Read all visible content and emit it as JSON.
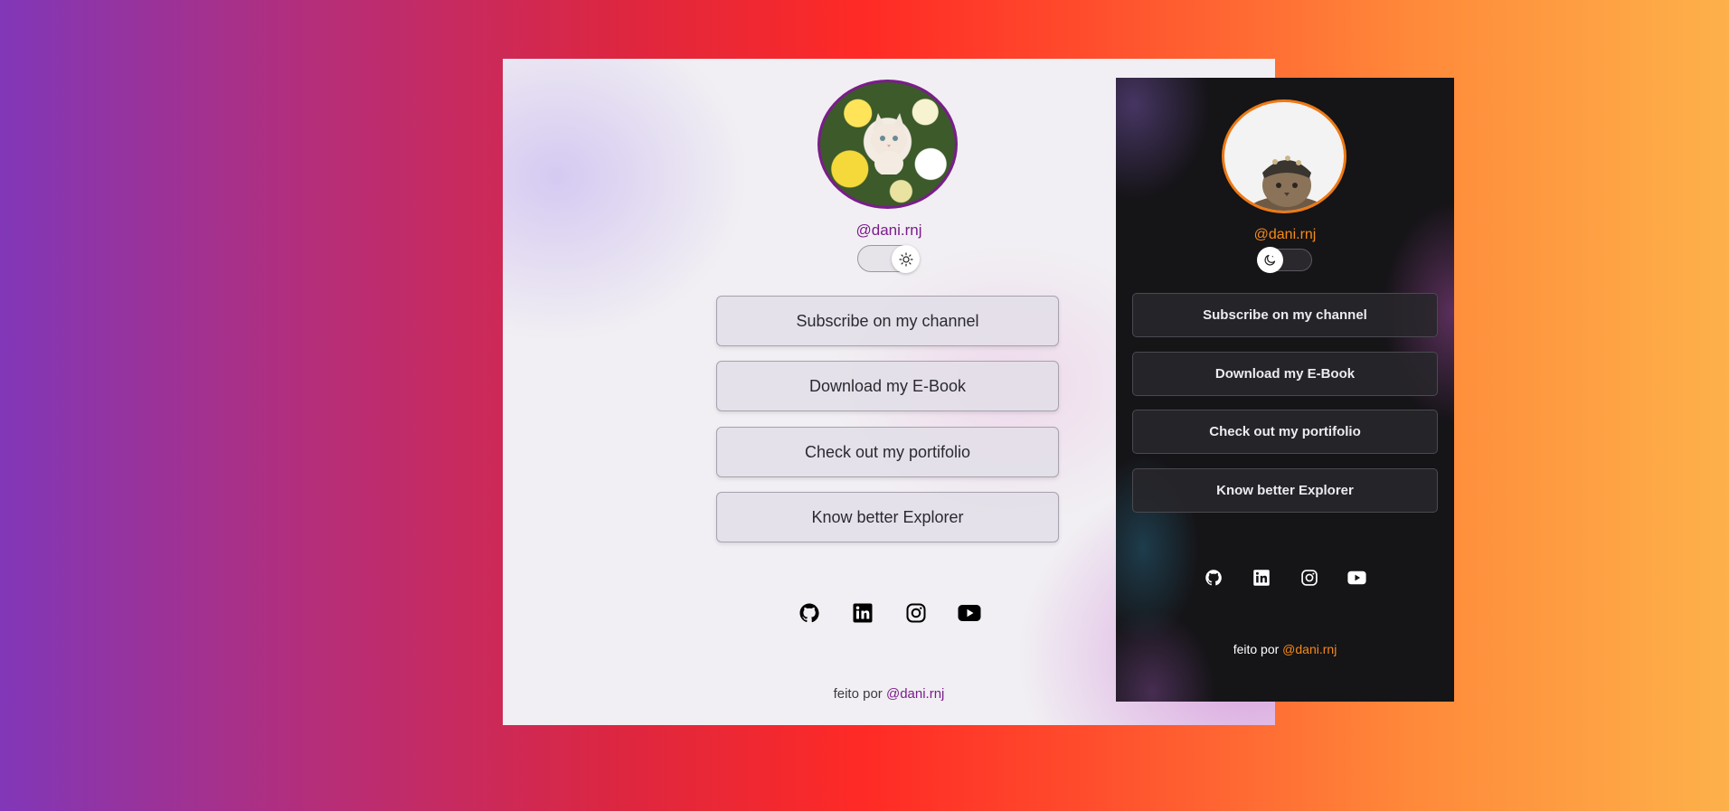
{
  "light": {
    "handle": "@dani.rnj",
    "theme_icon": "sun-icon",
    "buttons": [
      {
        "label": "Subscribe on my channel"
      },
      {
        "label": "Download my E-Book"
      },
      {
        "label": "Check out my portifolio"
      },
      {
        "label": "Know better Explorer"
      }
    ],
    "socials": [
      "github-icon",
      "linkedin-icon",
      "instagram-icon",
      "youtube-icon"
    ],
    "footer": {
      "prefix": "feito por",
      "link": "@dani.rnj"
    },
    "colors": {
      "accent": "#7b1c8c",
      "background": "#f1eff3"
    }
  },
  "dark": {
    "handle": "@dani.rnj",
    "theme_icon": "moon-icon",
    "buttons": [
      {
        "label": "Subscribe on my channel"
      },
      {
        "label": "Download my E-Book"
      },
      {
        "label": "Check out my portifolio"
      },
      {
        "label": "Know better Explorer"
      }
    ],
    "socials": [
      "github-icon",
      "linkedin-icon",
      "instagram-icon",
      "youtube-icon"
    ],
    "footer": {
      "prefix": "feito por",
      "link": "@dani.rnj"
    },
    "colors": {
      "accent": "#f58a18",
      "background": "#151417"
    }
  },
  "page": {
    "colors": {
      "gradient_start": "#8137b8",
      "gradient_mid": "#ff2a25",
      "gradient_end": "#fdb14a"
    }
  }
}
